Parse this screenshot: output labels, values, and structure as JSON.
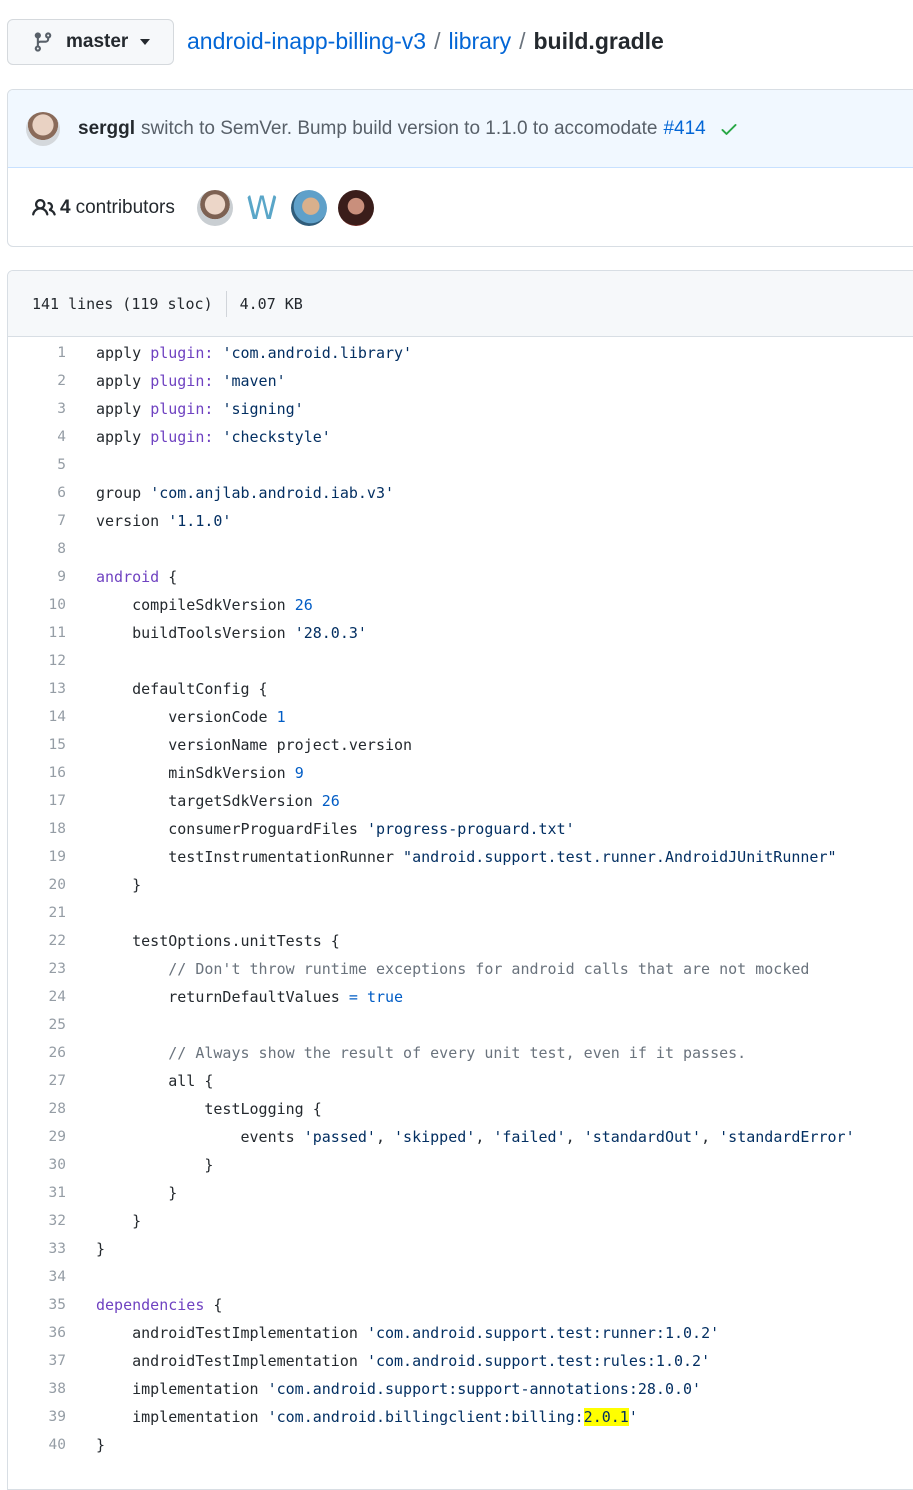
{
  "branch": {
    "name": "master",
    "icon": "git-branch-icon"
  },
  "breadcrumb": {
    "repo": "android-inapp-billing-v3",
    "sep1": "/",
    "folder": "library",
    "sep2": "/",
    "file": "build.gradle"
  },
  "commit": {
    "author": "serggl",
    "message": "switch to SemVer. Bump build version to 1.1.0 to accomodate",
    "pr": "#414",
    "status_icon": "check-icon"
  },
  "contributors": {
    "count": "4",
    "label": "contributors",
    "avatar_letter": "W"
  },
  "file_info": {
    "lines": "141 lines (119 sloc)",
    "size": "4.07 KB"
  },
  "colors": {
    "link": "#0366d6",
    "keyword": "#6f42c1",
    "string": "#032f62",
    "number": "#005cc5",
    "comment": "#6a737d",
    "highlight": "#ffff00",
    "success": "#28a745"
  },
  "code_lines": [
    {
      "n": "1",
      "parts": [
        {
          "t": "apply "
        },
        {
          "t": "plugin:",
          "c": "kw"
        },
        {
          "t": " "
        },
        {
          "t": "'com.android.library'",
          "c": "str"
        }
      ]
    },
    {
      "n": "2",
      "parts": [
        {
          "t": "apply "
        },
        {
          "t": "plugin:",
          "c": "kw"
        },
        {
          "t": " "
        },
        {
          "t": "'maven'",
          "c": "str"
        }
      ]
    },
    {
      "n": "3",
      "parts": [
        {
          "t": "apply "
        },
        {
          "t": "plugin:",
          "c": "kw"
        },
        {
          "t": " "
        },
        {
          "t": "'signing'",
          "c": "str"
        }
      ]
    },
    {
      "n": "4",
      "parts": [
        {
          "t": "apply "
        },
        {
          "t": "plugin:",
          "c": "kw"
        },
        {
          "t": " "
        },
        {
          "t": "'checkstyle'",
          "c": "str"
        }
      ]
    },
    {
      "n": "5",
      "parts": []
    },
    {
      "n": "6",
      "parts": [
        {
          "t": "group "
        },
        {
          "t": "'com.anjlab.android.iab.v3'",
          "c": "str"
        }
      ]
    },
    {
      "n": "7",
      "parts": [
        {
          "t": "version "
        },
        {
          "t": "'1.1.0'",
          "c": "str"
        }
      ]
    },
    {
      "n": "8",
      "parts": []
    },
    {
      "n": "9",
      "parts": [
        {
          "t": "android",
          "c": "kw"
        },
        {
          "t": " {"
        }
      ]
    },
    {
      "n": "10",
      "parts": [
        {
          "t": "    compileSdkVersion "
        },
        {
          "t": "26",
          "c": "num"
        }
      ]
    },
    {
      "n": "11",
      "parts": [
        {
          "t": "    buildToolsVersion "
        },
        {
          "t": "'28.0.3'",
          "c": "str"
        }
      ]
    },
    {
      "n": "12",
      "parts": []
    },
    {
      "n": "13",
      "parts": [
        {
          "t": "    defaultConfig {"
        }
      ]
    },
    {
      "n": "14",
      "parts": [
        {
          "t": "        versionCode "
        },
        {
          "t": "1",
          "c": "num"
        }
      ]
    },
    {
      "n": "15",
      "parts": [
        {
          "t": "        versionName project.version"
        }
      ]
    },
    {
      "n": "16",
      "parts": [
        {
          "t": "        minSdkVersion "
        },
        {
          "t": "9",
          "c": "num"
        }
      ]
    },
    {
      "n": "17",
      "parts": [
        {
          "t": "        targetSdkVersion "
        },
        {
          "t": "26",
          "c": "num"
        }
      ]
    },
    {
      "n": "18",
      "parts": [
        {
          "t": "        consumerProguardFiles "
        },
        {
          "t": "'progress-proguard.txt'",
          "c": "str"
        }
      ]
    },
    {
      "n": "19",
      "parts": [
        {
          "t": "        testInstrumentationRunner "
        },
        {
          "t": "\"android.support.test.runner.AndroidJUnitRunner\"",
          "c": "str"
        }
      ]
    },
    {
      "n": "20",
      "parts": [
        {
          "t": "    }"
        }
      ]
    },
    {
      "n": "21",
      "parts": []
    },
    {
      "n": "22",
      "parts": [
        {
          "t": "    testOptions.unitTests {"
        }
      ]
    },
    {
      "n": "23",
      "parts": [
        {
          "t": "        // Don't throw runtime exceptions for android calls that are not mocked",
          "c": "com"
        }
      ]
    },
    {
      "n": "24",
      "parts": [
        {
          "t": "        returnDefaultValues "
        },
        {
          "t": "=",
          "c": "num"
        },
        {
          "t": " "
        },
        {
          "t": "true",
          "c": "num"
        }
      ]
    },
    {
      "n": "25",
      "parts": []
    },
    {
      "n": "26",
      "parts": [
        {
          "t": "        // Always show the result of every unit test, even if it passes.",
          "c": "com"
        }
      ]
    },
    {
      "n": "27",
      "parts": [
        {
          "t": "        all {"
        }
      ]
    },
    {
      "n": "28",
      "parts": [
        {
          "t": "            testLogging {"
        }
      ]
    },
    {
      "n": "29",
      "parts": [
        {
          "t": "                events "
        },
        {
          "t": "'passed'",
          "c": "str"
        },
        {
          "t": ", "
        },
        {
          "t": "'skipped'",
          "c": "str"
        },
        {
          "t": ", "
        },
        {
          "t": "'failed'",
          "c": "str"
        },
        {
          "t": ", "
        },
        {
          "t": "'standardOut'",
          "c": "str"
        },
        {
          "t": ", "
        },
        {
          "t": "'standardError'",
          "c": "str"
        }
      ]
    },
    {
      "n": "30",
      "parts": [
        {
          "t": "            }"
        }
      ]
    },
    {
      "n": "31",
      "parts": [
        {
          "t": "        }"
        }
      ]
    },
    {
      "n": "32",
      "parts": [
        {
          "t": "    }"
        }
      ]
    },
    {
      "n": "33",
      "parts": [
        {
          "t": "}"
        }
      ]
    },
    {
      "n": "34",
      "parts": []
    },
    {
      "n": "35",
      "parts": [
        {
          "t": "dependencies",
          "c": "kw"
        },
        {
          "t": " {"
        }
      ]
    },
    {
      "n": "36",
      "parts": [
        {
          "t": "    androidTestImplementation "
        },
        {
          "t": "'com.android.support.test:runner:1.0.2'",
          "c": "str"
        }
      ]
    },
    {
      "n": "37",
      "parts": [
        {
          "t": "    androidTestImplementation "
        },
        {
          "t": "'com.android.support.test:rules:1.0.2'",
          "c": "str"
        }
      ]
    },
    {
      "n": "38",
      "parts": [
        {
          "t": "    implementation "
        },
        {
          "t": "'com.android.support:support-annotations:28.0.0'",
          "c": "str"
        }
      ]
    },
    {
      "n": "39",
      "parts": [
        {
          "t": "    implementation "
        },
        {
          "t": "'com.android.billingclient:billing:",
          "c": "str"
        },
        {
          "t": "2.0.1",
          "c": "str hl"
        },
        {
          "t": "'",
          "c": "str"
        }
      ]
    },
    {
      "n": "40",
      "parts": [
        {
          "t": "}"
        }
      ]
    }
  ]
}
